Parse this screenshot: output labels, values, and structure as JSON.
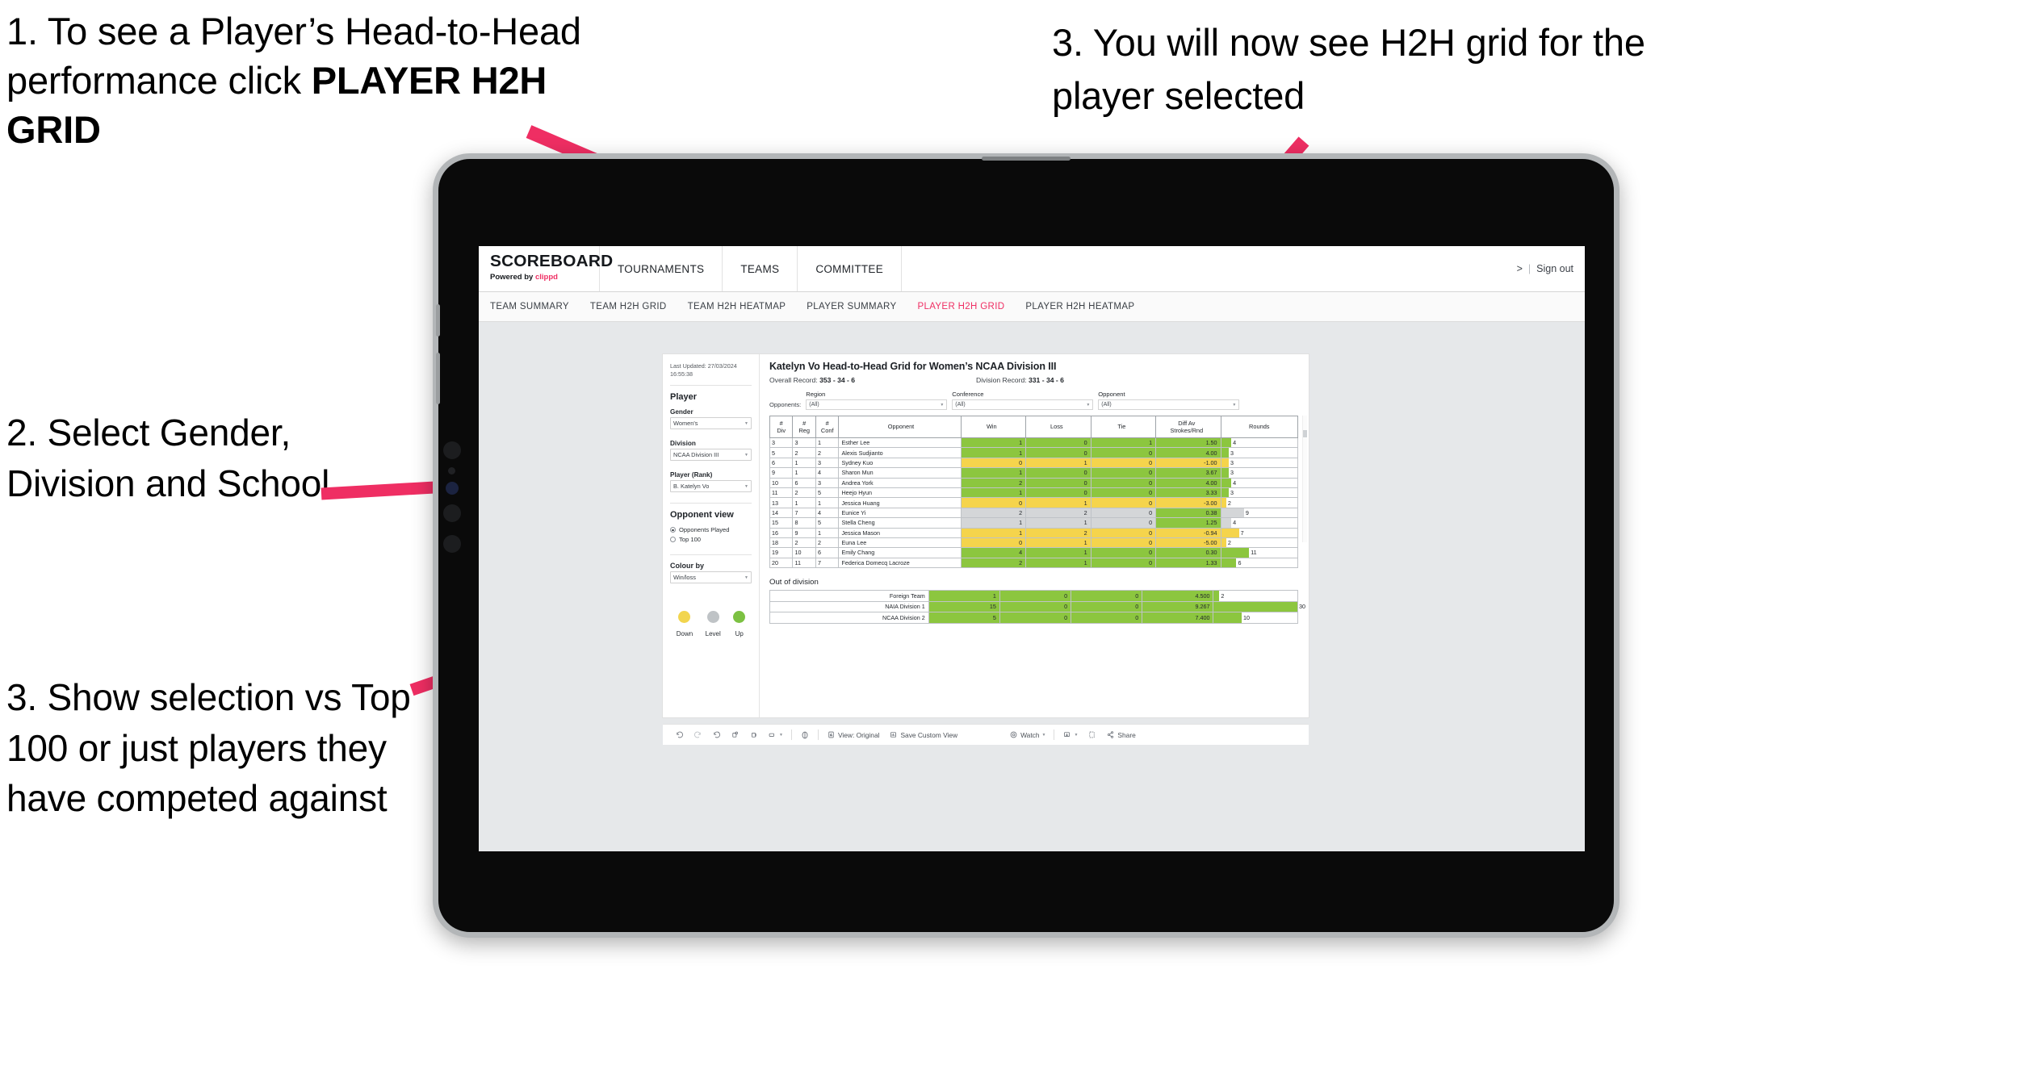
{
  "annotations": {
    "a1_line1": "1. To see a Player’s Head-to-Head performance click ",
    "a1_bold": "PLAYER H2H GRID",
    "a2": "2. Select Gender, Division and School",
    "a3": "3. Show selection vs Top 100 or just players they have competed against",
    "a4": "3. You will now see H2H grid for the player selected",
    "arrow_color": "#ef2e63"
  },
  "app": {
    "brand_name": "SCOREBOARD",
    "brand_sub_prefix": "Powered by ",
    "brand_sub_accent": "clippd",
    "top_nav": [
      "TOURNAMENTS",
      "TEAMS",
      "COMMITTEE"
    ],
    "account_chevron": ">",
    "account_sep": "|",
    "sign_out": "Sign out",
    "sub_nav": [
      {
        "label": "TEAM SUMMARY",
        "active": false
      },
      {
        "label": "TEAM H2H GRID",
        "active": false
      },
      {
        "label": "TEAM H2H HEATMAP",
        "active": false
      },
      {
        "label": "PLAYER SUMMARY",
        "active": false
      },
      {
        "label": "PLAYER H2H GRID",
        "active": true
      },
      {
        "label": "PLAYER H2H HEATMAP",
        "active": false
      }
    ],
    "accent_color": "#ef2e63"
  },
  "pane": {
    "last_updated": "Last Updated: 27/03/2024 16:55:38",
    "player_heading": "Player",
    "filters": [
      {
        "label": "Gender",
        "value": "Women's"
      },
      {
        "label": "Division",
        "value": "NCAA Division III"
      },
      {
        "label": "Player (Rank)",
        "value": "B. Katelyn Vo"
      }
    ],
    "opponent_view_heading": "Opponent view",
    "opponent_view_options": [
      {
        "label": "Opponents Played",
        "selected": true
      },
      {
        "label": "Top 100",
        "selected": false
      }
    ],
    "colour_by_label": "Colour by",
    "colour_by_value": "Win/loss",
    "legend": [
      {
        "label": "Down",
        "color": "#f2d54e"
      },
      {
        "label": "Level",
        "color": "#bfc3c6"
      },
      {
        "label": "Up",
        "color": "#7cc142"
      }
    ]
  },
  "viz": {
    "title": "Katelyn Vo Head-to-Head Grid for Women’s NCAA Division III",
    "overall_record_label": "Overall Record: ",
    "overall_record_value": "353 -  34 - 6",
    "division_record_label": "Division Record: ",
    "division_record_value": "331 -  34 - 6",
    "opponents_label": "Opponents:",
    "opponent_filters": [
      {
        "label": "Region",
        "value": "(All)"
      },
      {
        "label": "Conference",
        "value": "(All)"
      },
      {
        "label": "Opponent",
        "value": "(All)"
      }
    ],
    "out_of_division_heading": "Out of division"
  },
  "chart_data": {
    "type": "table",
    "title": "Katelyn Vo Head-to-Head Grid for Women’s NCAA Division III",
    "columns": [
      "# Div",
      "# Reg",
      "# Conf",
      "Opponent",
      "Win",
      "Loss",
      "Tie",
      "Diff Av Strokes/Rnd",
      "Rounds"
    ],
    "column_header_lines": [
      [
        "#",
        "Div"
      ],
      [
        "#",
        "Reg"
      ],
      [
        "#",
        "Conf"
      ],
      [
        "Opponent"
      ],
      [
        "Win"
      ],
      [
        "Loss"
      ],
      [
        "Tie"
      ],
      [
        "Diff Av",
        "Strokes/Rnd"
      ],
      [
        "Rounds"
      ]
    ],
    "colour_scale": {
      "up": "#8cc63f",
      "down": "#f5d44c",
      "level": "#d4d6d8"
    },
    "rounds_max": 30,
    "rows": [
      {
        "div": "3",
        "reg": "3",
        "conf": "1",
        "opponent": "Esther Lee",
        "win": "1",
        "loss": "0",
        "tie": "1",
        "diff": "1.50",
        "rounds": "4",
        "state": "up"
      },
      {
        "div": "5",
        "reg": "2",
        "conf": "2",
        "opponent": "Alexis Sudjianto",
        "win": "1",
        "loss": "0",
        "tie": "0",
        "diff": "4.00",
        "rounds": "3",
        "state": "up"
      },
      {
        "div": "6",
        "reg": "1",
        "conf": "3",
        "opponent": "Sydney Kuo",
        "win": "0",
        "loss": "1",
        "tie": "0",
        "diff": "-1.00",
        "rounds": "3",
        "state": "down"
      },
      {
        "div": "9",
        "reg": "1",
        "conf": "4",
        "opponent": "Sharon Mun",
        "win": "1",
        "loss": "0",
        "tie": "0",
        "diff": "3.67",
        "rounds": "3",
        "state": "up"
      },
      {
        "div": "10",
        "reg": "6",
        "conf": "3",
        "opponent": "Andrea York",
        "win": "2",
        "loss": "0",
        "tie": "0",
        "diff": "4.00",
        "rounds": "4",
        "state": "up"
      },
      {
        "div": "11",
        "reg": "2",
        "conf": "5",
        "opponent": "Heejo Hyun",
        "win": "1",
        "loss": "0",
        "tie": "0",
        "diff": "3.33",
        "rounds": "3",
        "state": "up"
      },
      {
        "div": "13",
        "reg": "1",
        "conf": "1",
        "opponent": "Jessica Huang",
        "win": "0",
        "loss": "1",
        "tie": "0",
        "diff": "-3.00",
        "rounds": "2",
        "state": "down"
      },
      {
        "div": "14",
        "reg": "7",
        "conf": "4",
        "opponent": "Eunice Yi",
        "win": "2",
        "loss": "2",
        "tie": "0",
        "diff": "0.38",
        "rounds": "9",
        "state": "level",
        "diff_state": "up"
      },
      {
        "div": "15",
        "reg": "8",
        "conf": "5",
        "opponent": "Stella Cheng",
        "win": "1",
        "loss": "1",
        "tie": "0",
        "diff": "1.25",
        "rounds": "4",
        "state": "level",
        "diff_state": "up"
      },
      {
        "div": "16",
        "reg": "9",
        "conf": "1",
        "opponent": "Jessica Mason",
        "win": "1",
        "loss": "2",
        "tie": "0",
        "diff": "-0.94",
        "rounds": "7",
        "state": "down"
      },
      {
        "div": "18",
        "reg": "2",
        "conf": "2",
        "opponent": "Euna Lee",
        "win": "0",
        "loss": "1",
        "tie": "0",
        "diff": "-5.00",
        "rounds": "2",
        "state": "down"
      },
      {
        "div": "19",
        "reg": "10",
        "conf": "6",
        "opponent": "Emily Chang",
        "win": "4",
        "loss": "1",
        "tie": "0",
        "diff": "0.30",
        "rounds": "11",
        "state": "up"
      },
      {
        "div": "20",
        "reg": "11",
        "conf": "7",
        "opponent": "Federica Domecq Lacroze",
        "win": "2",
        "loss": "1",
        "tie": "0",
        "diff": "1.33",
        "rounds": "6",
        "state": "up"
      }
    ],
    "out_of_division_rows": [
      {
        "opponent": "Foreign Team",
        "win": "1",
        "loss": "0",
        "tie": "0",
        "diff": "4.500",
        "rounds": "2",
        "state": "up"
      },
      {
        "opponent": "NAIA Division 1",
        "win": "15",
        "loss": "0",
        "tie": "0",
        "diff": "9.267",
        "rounds": "30",
        "state": "up"
      },
      {
        "opponent": "NCAA Division 2",
        "win": "5",
        "loss": "0",
        "tie": "0",
        "diff": "7.400",
        "rounds": "10",
        "state": "up"
      }
    ]
  },
  "toolbar": {
    "undo": "undo-icon",
    "redo": "redo-icon",
    "revert": "revert-icon",
    "refresh": "refresh-data-icon",
    "pause": "pause-updates-icon",
    "view_original_label": "View: Original",
    "save_custom_view_label": "Save Custom View",
    "watch_label": "Watch",
    "download_label": "download-icon",
    "fullscreen_label": "fullscreen-icon",
    "share_label": "Share"
  }
}
